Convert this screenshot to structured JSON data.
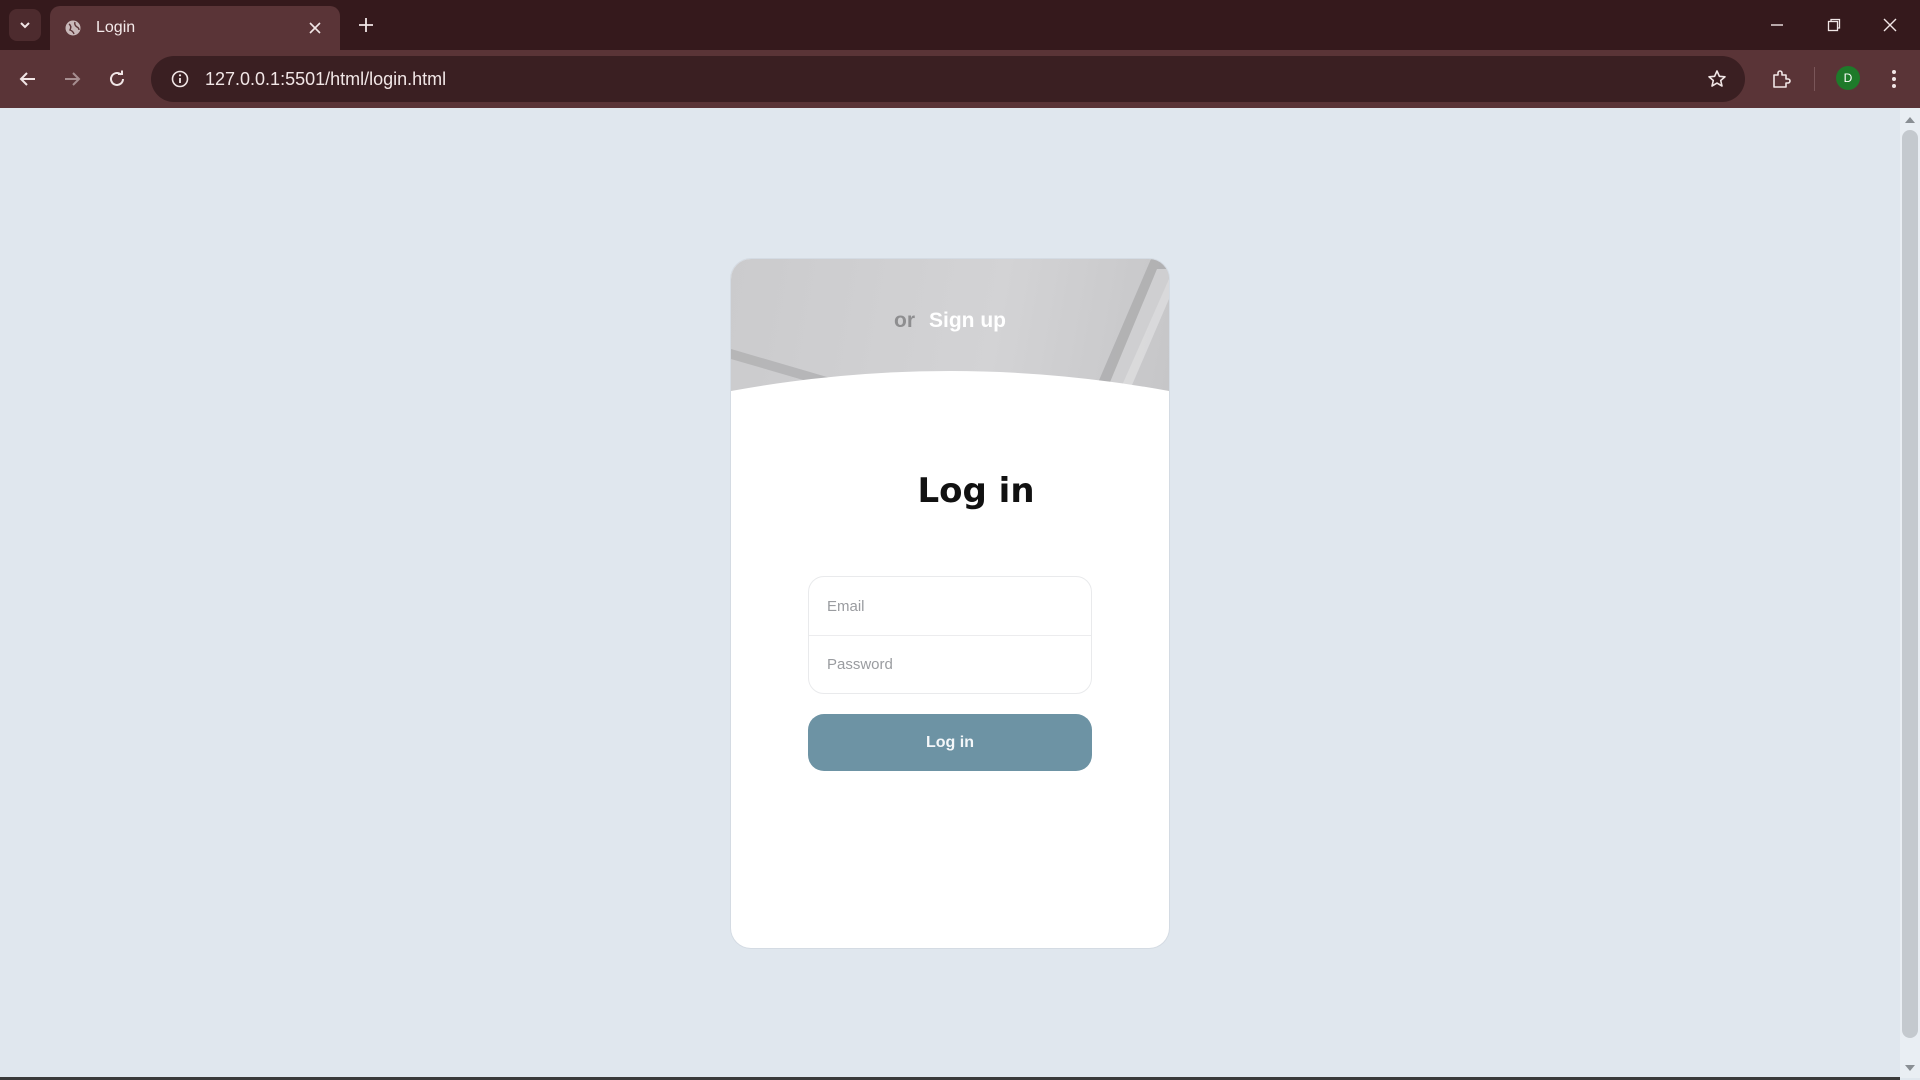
{
  "browser": {
    "tab_title": "Login",
    "url": "127.0.0.1:5501/html/login.html",
    "profile_initial": "D",
    "icons": [
      "tab-search-icon",
      "globe-icon",
      "close-icon",
      "plus-icon",
      "minimize-icon",
      "restore-icon",
      "window-close-icon",
      "back-arrow-icon",
      "forward-arrow-icon",
      "reload-icon",
      "info-icon",
      "star-icon",
      "extensions-icon",
      "kebab-menu-icon"
    ]
  },
  "login_card": {
    "header_or": "or",
    "header_signup": "Sign up",
    "title": "Log in",
    "email_placeholder": "Email",
    "password_placeholder": "Password",
    "submit_label": "Log in"
  },
  "colors": {
    "page_bg": "#e0e7ee",
    "button": "#6d93a4",
    "chrome_dark": "#35191c",
    "chrome_toolbar": "#5a3437"
  }
}
